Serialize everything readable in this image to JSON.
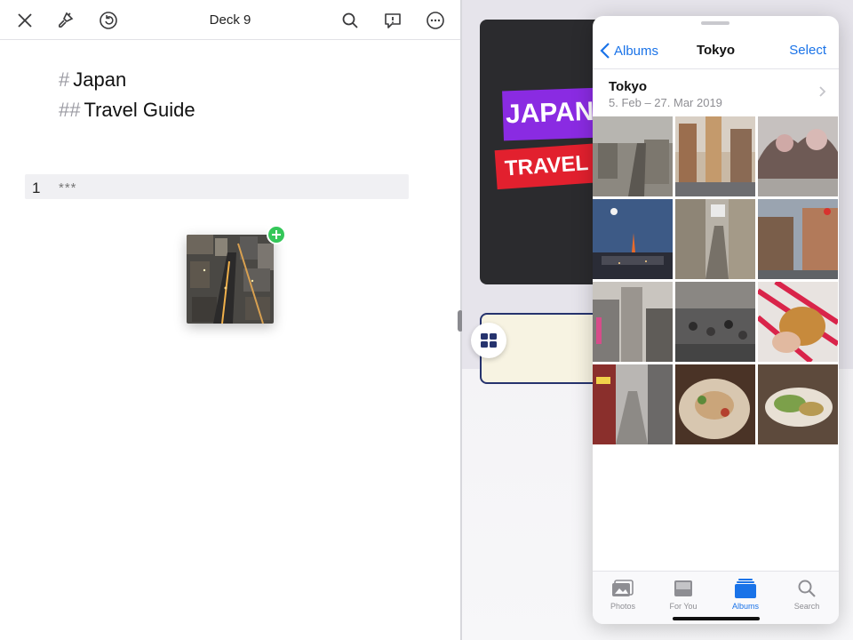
{
  "editor": {
    "title": "Deck 9",
    "heading1_hash": "#",
    "heading1": "Japan",
    "heading2_hash": "##",
    "heading2": "Travel Guide",
    "slide_number": "1",
    "slide_separator": "***"
  },
  "preview": {
    "banner_line1": "JAPAN",
    "banner_line2": "TRAVEL"
  },
  "photos": {
    "back_label": "Albums",
    "title": "Tokyo",
    "select_label": "Select",
    "album_name": "Tokyo",
    "album_dates": "5. Feb – 27. Mar 2019",
    "tabs": [
      {
        "label": "Photos",
        "icon": "photos-icon",
        "active": false
      },
      {
        "label": "For You",
        "icon": "for-you-icon",
        "active": false
      },
      {
        "label": "Albums",
        "icon": "albums-icon",
        "active": true
      },
      {
        "label": "Search",
        "icon": "search-icon",
        "active": false
      }
    ]
  },
  "colors": {
    "accent": "#1a73e8",
    "add_badge": "#34c759",
    "banner_purple": "#8a2be2",
    "banner_red": "#e2202e"
  }
}
